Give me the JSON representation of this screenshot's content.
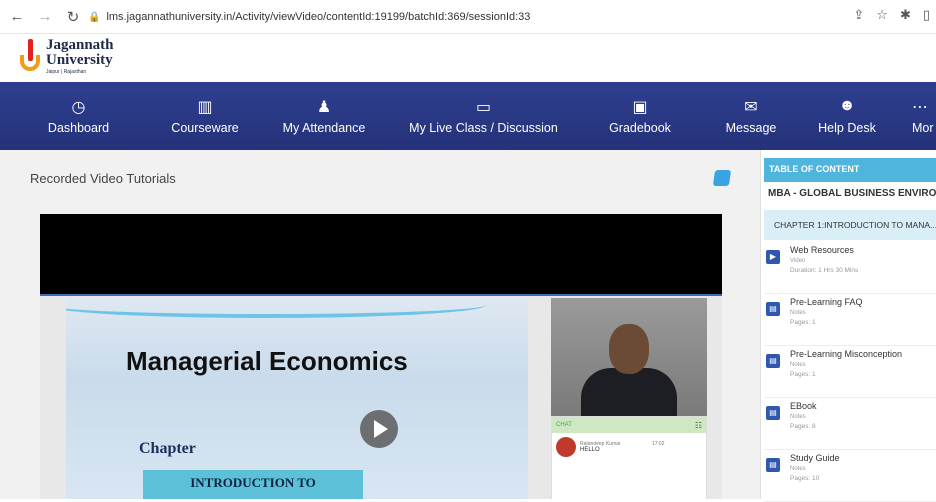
{
  "browser": {
    "url": "lms.jagannathuniversity.in/Activity/viewVideo/contentId:19199/batchId:369/sessionId:33"
  },
  "logo": {
    "line1": "Jagannath",
    "line2": "University",
    "line3": "Jaipur | Rajasthan"
  },
  "nav": [
    {
      "label": "Dashboard",
      "icon": "dashboard-icon"
    },
    {
      "label": "Courseware",
      "icon": "book-icon"
    },
    {
      "label": "My Attendance",
      "icon": "user-check-icon"
    },
    {
      "label": "My Live Class / Discussion",
      "icon": "presentation-icon"
    },
    {
      "label": "Gradebook",
      "icon": "clipboard-icon"
    },
    {
      "label": "Message",
      "icon": "envelope-icon"
    },
    {
      "label": "Help Desk",
      "icon": "support-icon"
    },
    {
      "label": "Mor",
      "icon": "more-icon"
    }
  ],
  "content": {
    "title": "Recorded Video Tutorials"
  },
  "video": {
    "slide_title": "Managerial Economics",
    "slide_chapter": "Chapter",
    "slide_box": "INTRODUCTION TO",
    "chat_label": "CHAT",
    "chat_name": "Ratandeep Kumar",
    "chat_time": "17:02",
    "chat_message": "HELLO"
  },
  "sidebar": {
    "toc_header": "TABLE OF CONTENT",
    "course_title": "MBA - GLOBAL BUSINESS ENVIRONM",
    "chapter": "CHAPTER 1:INTRODUCTION TO MANA...",
    "items": [
      {
        "name": "Web Resources",
        "type": "Video",
        "meta": "Duration: 1 Hrs 30 Mins"
      },
      {
        "name": "Pre-Learning FAQ",
        "type": "Notes",
        "meta": "Pages: 1"
      },
      {
        "name": "Pre-Learning Misconception",
        "type": "Notes",
        "meta": "Pages: 1"
      },
      {
        "name": "EBook",
        "type": "Notes",
        "meta": "Pages: 8"
      },
      {
        "name": "Study Guide",
        "type": "Notes",
        "meta": "Pages: 10"
      }
    ]
  }
}
